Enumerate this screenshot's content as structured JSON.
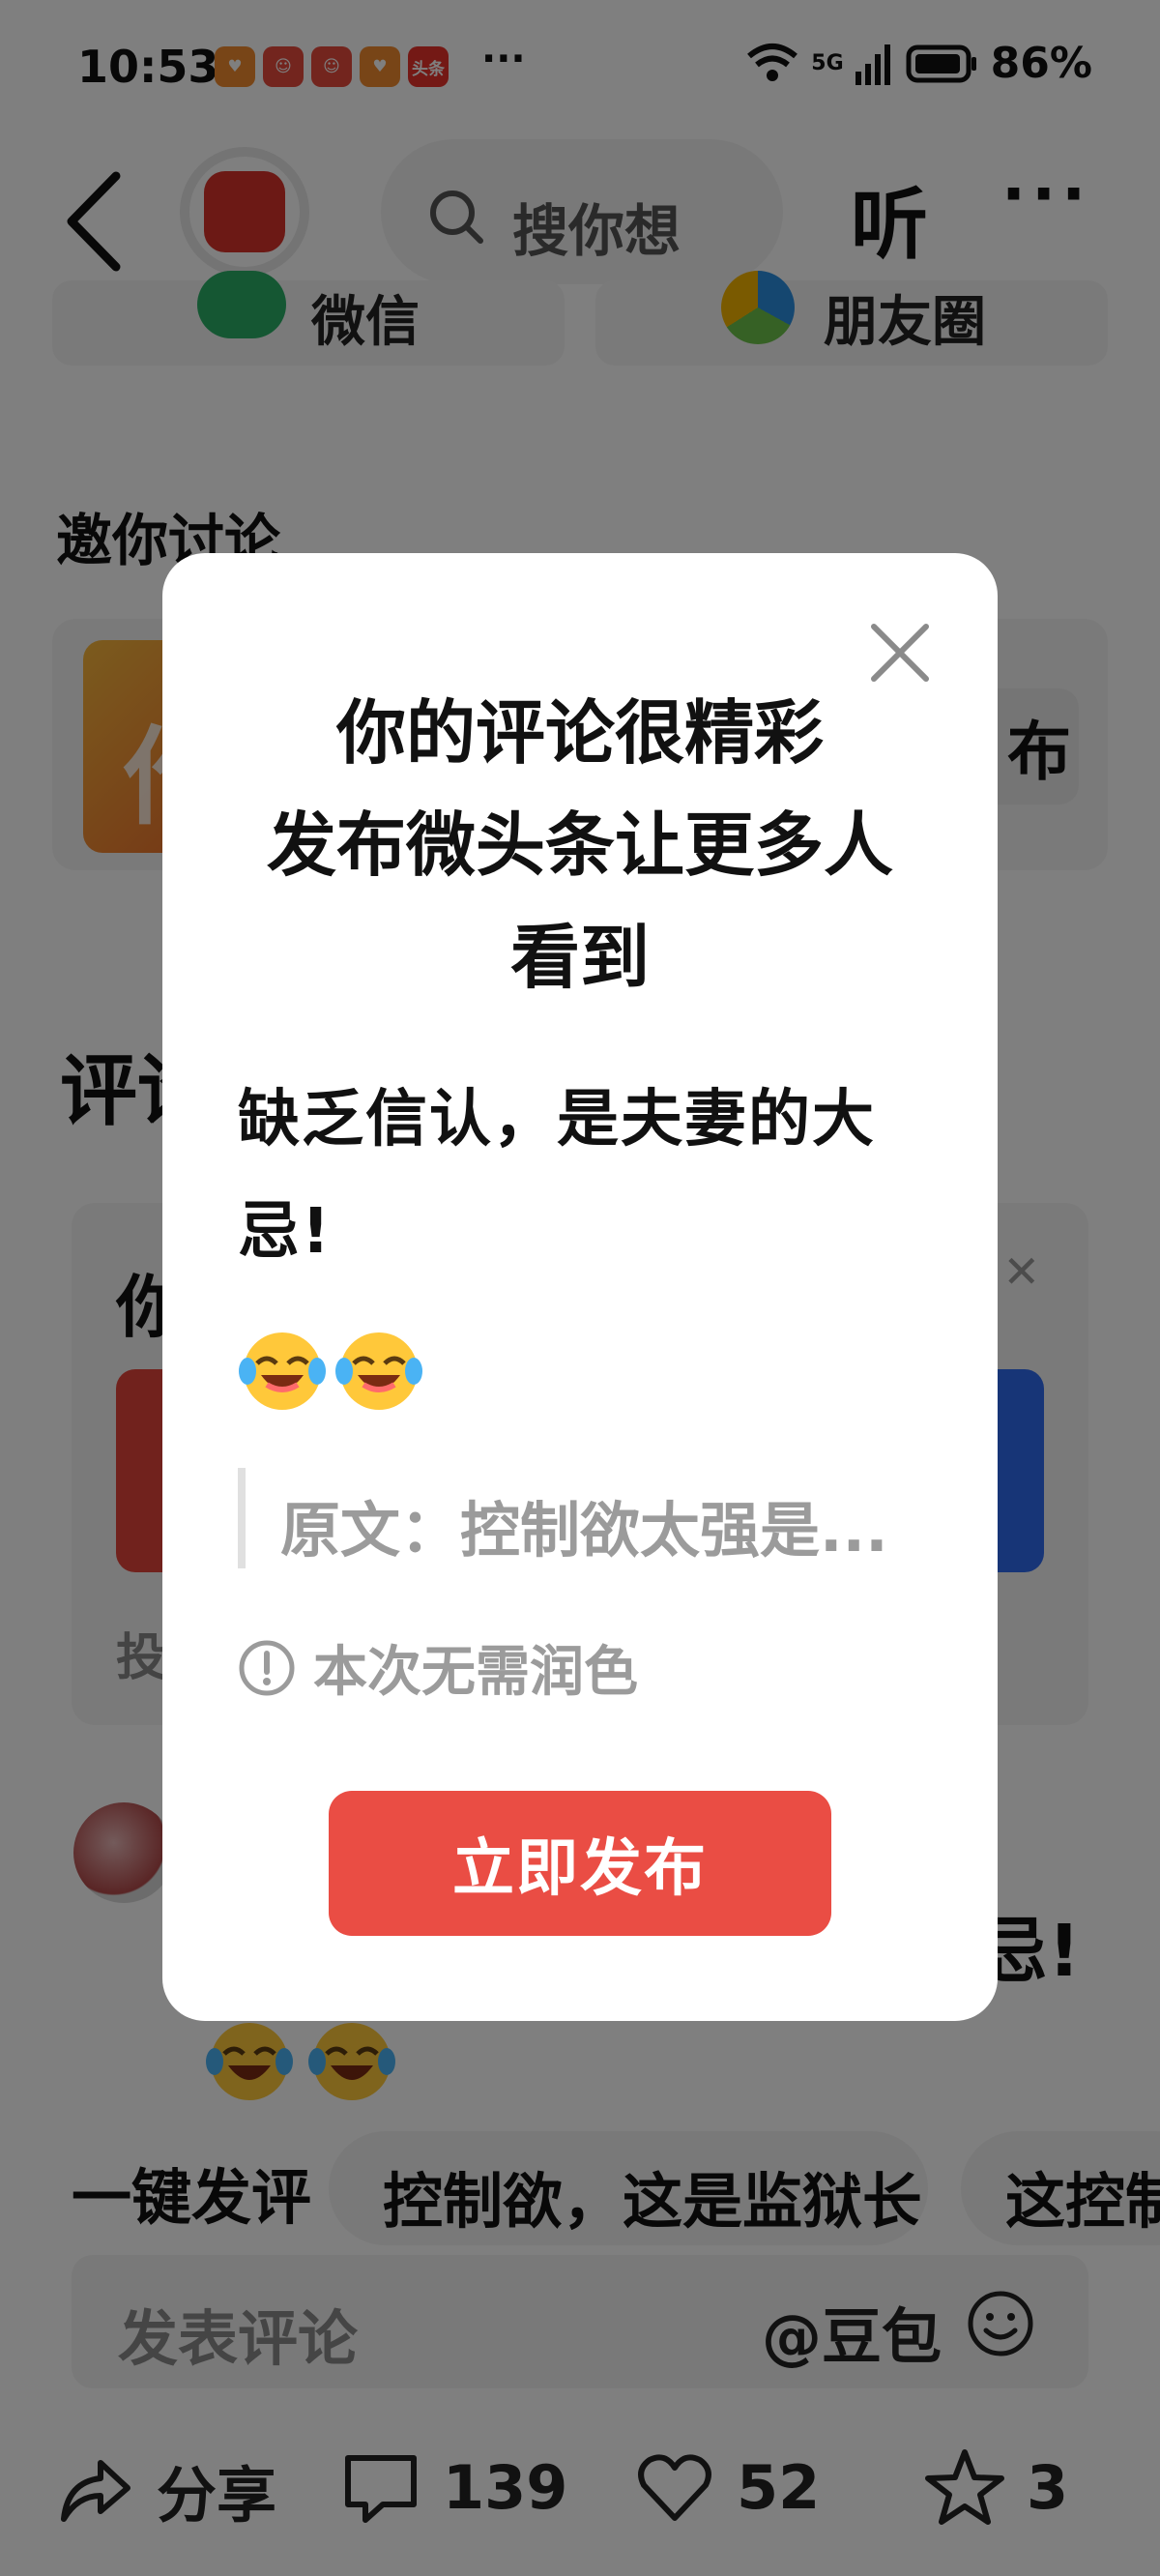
{
  "status_bar": {
    "time": "10:53",
    "more": "···",
    "network": "5G",
    "battery": "86%",
    "app_badges": [
      {
        "icon": "heart-app-icon",
        "color": "#f08a2e",
        "label": "♥"
      },
      {
        "icon": "clown-app-icon",
        "color": "#e64a3c",
        "label": "☺"
      },
      {
        "icon": "clown-app-icon",
        "color": "#e64a3c",
        "label": "☺"
      },
      {
        "icon": "heart-app-icon",
        "color": "#f08a2e",
        "label": "♥"
      },
      {
        "icon": "toutiao-app-icon",
        "color": "#e8322a",
        "label": "头条"
      }
    ]
  },
  "topbar": {
    "search_placeholder": "搜你想",
    "listen_label": "听",
    "more_label": "···"
  },
  "share": {
    "wechat": "微信",
    "moments": "朋友圈"
  },
  "invite": {
    "title": "邀你讨论",
    "avatar_char": "作",
    "publish_fragment": "布"
  },
  "comments_heading": "评论",
  "promo": {
    "title_fragment": "你",
    "sub_fragment": "投"
  },
  "comment": {
    "tail": "忌!"
  },
  "quick_comments": {
    "label": "一键发评",
    "chips": [
      "控制欲，这是监狱长",
      "这控制"
    ]
  },
  "comment_input": {
    "placeholder": "发表评论",
    "mention": "@豆包"
  },
  "actions": {
    "share": "分享",
    "comments": "139",
    "likes": "52",
    "favorites": "3"
  },
  "modal": {
    "title_lines": [
      "你的评论很精彩",
      "发布微头条让更多人",
      "看到"
    ],
    "comment_text": "缺乏信认，是夫妻的大忌!",
    "quote": "原文：控制欲太强是...",
    "notice": "本次无需润色",
    "publish_button": "立即发布"
  },
  "colors": {
    "accent": "#ea4d44",
    "overlay": "rgba(0,0,0,0.5)"
  }
}
